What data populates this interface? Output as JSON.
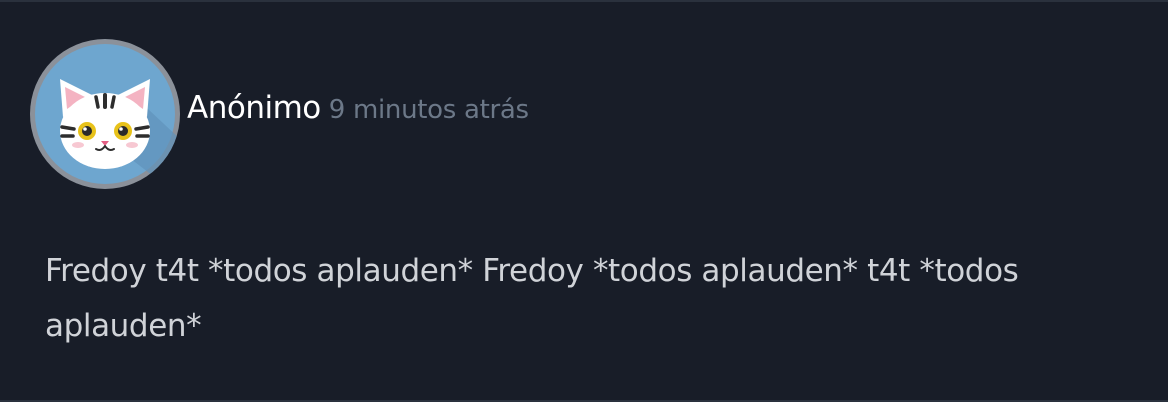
{
  "comment": {
    "author": "Anónimo",
    "timestamp": "9 minutos atrás",
    "text": "Fredoy t4t *todos aplauden* Fredoy *todos aplauden* t4t *todos aplauden*",
    "avatar_icon": "cat-face-icon"
  },
  "colors": {
    "background": "#181d28",
    "author": "#ffffff",
    "timestamp": "#6c7888",
    "text": "#d0d3d8",
    "avatar_bg": "#6ea6cf"
  }
}
